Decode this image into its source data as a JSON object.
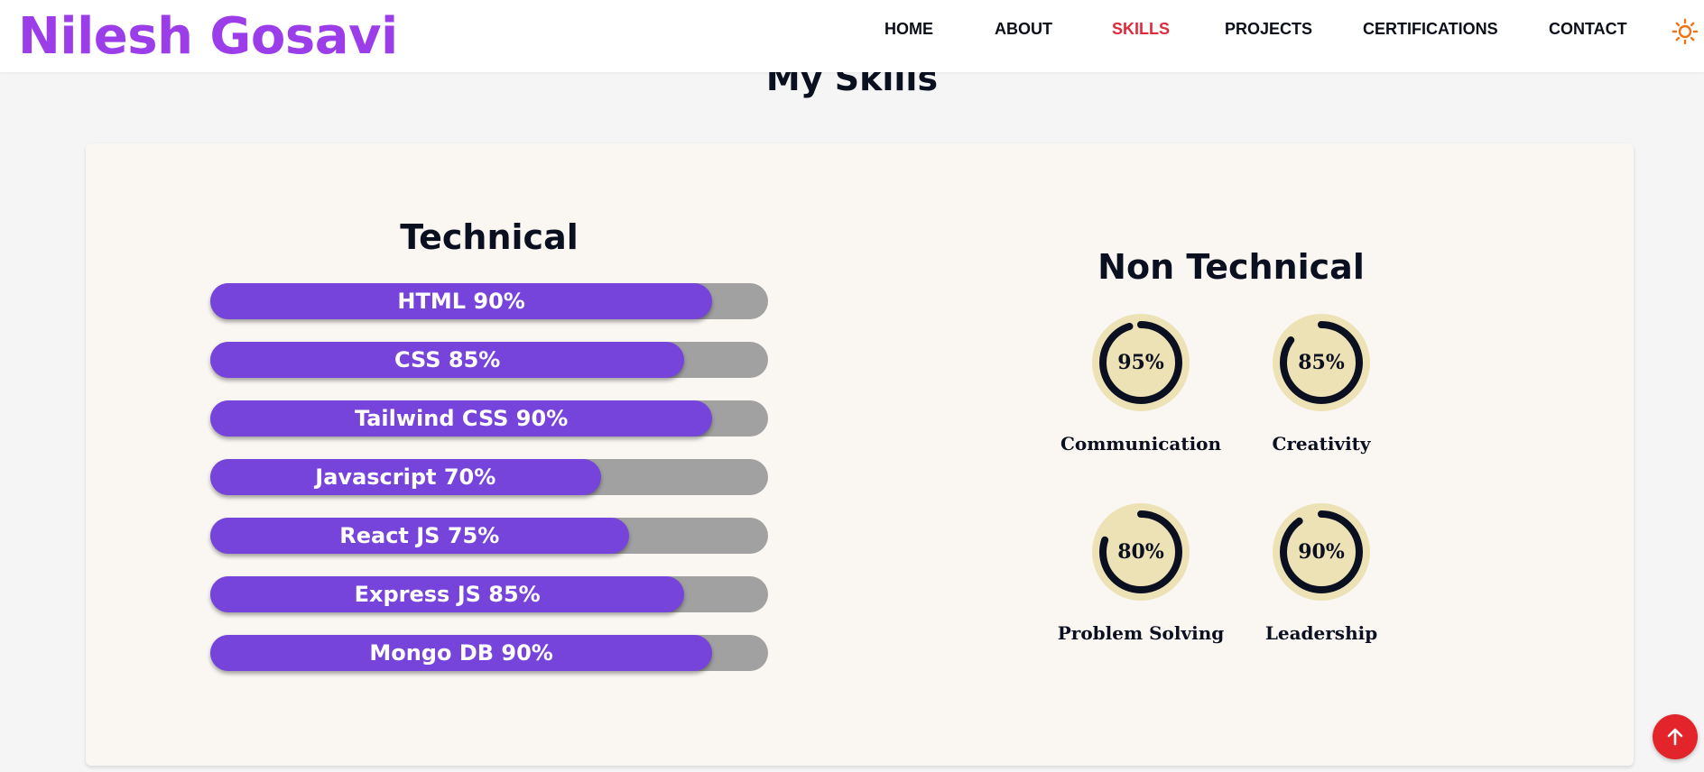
{
  "brand": "Nilesh Gosavi",
  "nav": [
    {
      "label": "HOME",
      "active": false
    },
    {
      "label": "ABOUT",
      "active": false
    },
    {
      "label": "SKILLS",
      "active": true
    },
    {
      "label": "PROJECTS",
      "active": false
    },
    {
      "label": "CERTIFICATIONS",
      "active": false
    },
    {
      "label": "CONTACT",
      "active": false
    }
  ],
  "theme_toggle_icon": "sun-icon",
  "section_title": "My Skills",
  "technical": {
    "title": "Technical",
    "skills": [
      {
        "label": "HTML 90%",
        "percent": 90
      },
      {
        "label": "CSS 85%",
        "percent": 85
      },
      {
        "label": "Tailwind CSS 90%",
        "percent": 90
      },
      {
        "label": "Javascript 70%",
        "percent": 70
      },
      {
        "label": "React JS 75%",
        "percent": 75
      },
      {
        "label": "Express JS 85%",
        "percent": 85
      },
      {
        "label": "Mongo DB 90%",
        "percent": 90
      }
    ]
  },
  "non_technical": {
    "title": "Non Technical",
    "skills": [
      {
        "name": "Communication",
        "value": "95%",
        "percent": 95
      },
      {
        "name": "Creativity",
        "value": "85%",
        "percent": 85
      },
      {
        "name": "Problem Solving",
        "value": "80%",
        "percent": 80
      },
      {
        "name": "Leadership",
        "value": "90%",
        "percent": 90
      }
    ]
  },
  "scroll_top_icon": "arrow-up-icon",
  "colors": {
    "brand": "#9b3de8",
    "active_nav": "#e0293a",
    "bar_fill": "#7744db",
    "bar_track": "#a1a1a1",
    "gauge_bg": "#ede2b6",
    "gauge_ring": "#0b1020",
    "scroll_top": "#e3252b",
    "theme_toggle": "#f07316"
  }
}
